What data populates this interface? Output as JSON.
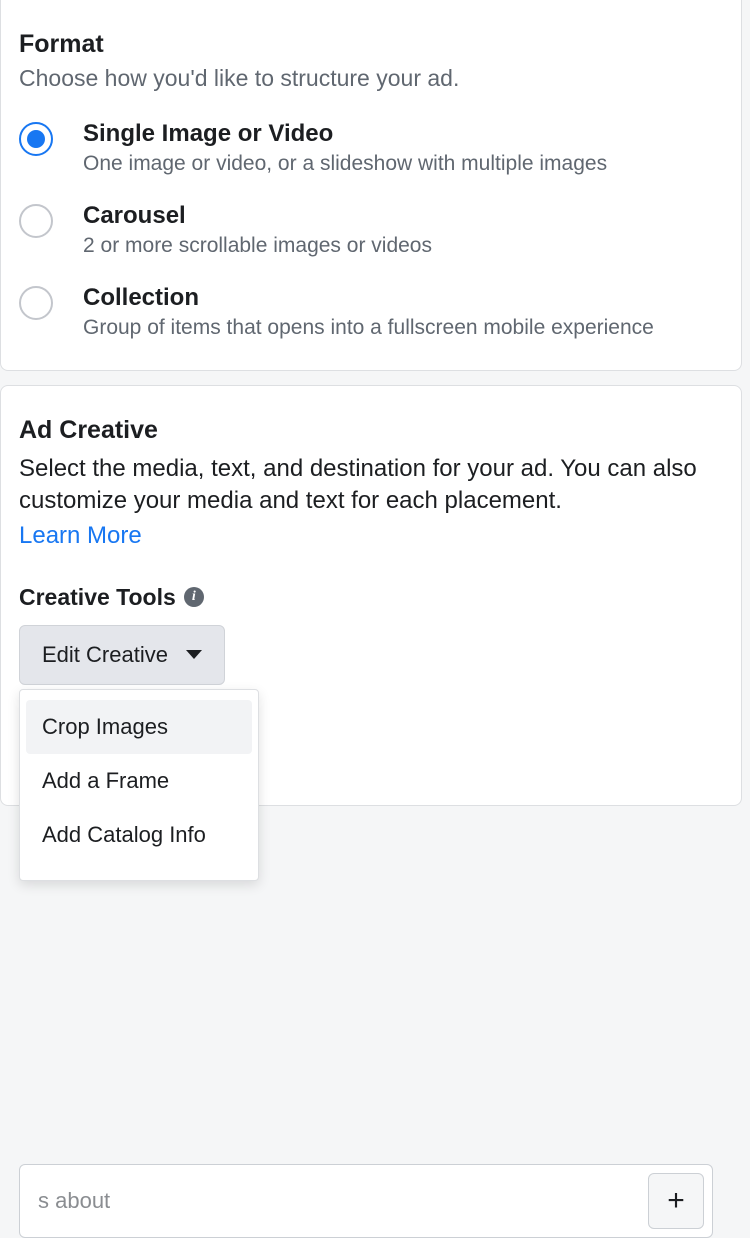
{
  "format": {
    "title": "Format",
    "subtitle": "Choose how you'd like to structure your ad.",
    "options": [
      {
        "label": "Single Image or Video",
        "desc": "One image or video, or a slideshow with multiple images",
        "selected": true
      },
      {
        "label": "Carousel",
        "desc": "2 or more scrollable images or videos",
        "selected": false
      },
      {
        "label": "Collection",
        "desc": "Group of items that opens into a fullscreen mobile experience",
        "selected": false
      }
    ]
  },
  "creative": {
    "title": "Ad Creative",
    "body": "Select the media, text, and destination for your ad. You can also customize your media and text for each placement.",
    "learn_more": "Learn More",
    "tools_label": "Creative Tools",
    "dropdown_label": "Edit Creative",
    "menu": [
      "Crop Images",
      "Add a Frame",
      "Add Catalog Info"
    ],
    "text_field_partial": "s about",
    "plus": "+"
  }
}
